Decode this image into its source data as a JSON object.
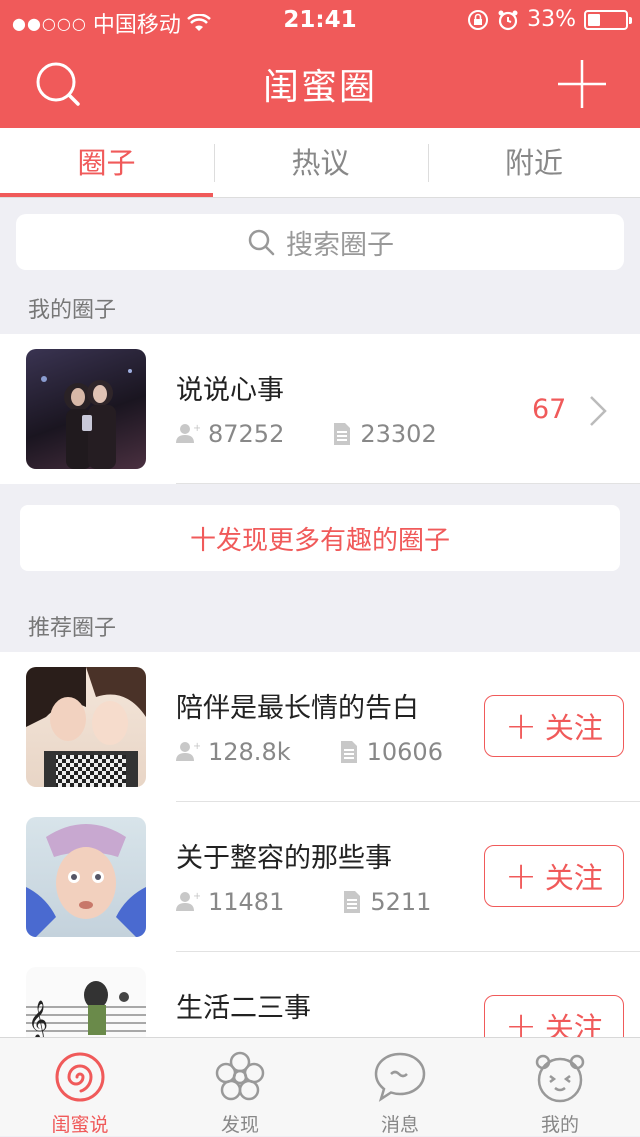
{
  "status_bar": {
    "carrier": "中国移动",
    "time": "21:41",
    "battery": "33%",
    "battery_level": 0.33
  },
  "header": {
    "title": "闺蜜圈",
    "left_icon": "search-icon",
    "right_icon": "plus-icon"
  },
  "tabs": [
    {
      "label": "圈子",
      "active": true
    },
    {
      "label": "热议",
      "active": false
    },
    {
      "label": "附近",
      "active": false
    }
  ],
  "search": {
    "placeholder": "搜索圈子"
  },
  "my_circles": {
    "title": "我的圈子",
    "items": [
      {
        "name": "说说心事",
        "members": "87252",
        "posts": "23302",
        "badge": "67"
      }
    ]
  },
  "discover_more": {
    "label": "十发现更多有趣的圈子"
  },
  "recommended": {
    "title": "推荐圈子",
    "follow_label": "关注",
    "items": [
      {
        "name": "陪伴是最长情的告白",
        "members": "128.8k",
        "posts": "10606"
      },
      {
        "name": "关于整容的那些事",
        "members": "11481",
        "posts": "5211"
      },
      {
        "name": "生活二三事",
        "members": "",
        "posts": ""
      }
    ]
  },
  "tabbar": [
    {
      "label": "闺蜜说",
      "icon": "swirl-icon",
      "active": true
    },
    {
      "label": "发现",
      "icon": "flower-icon",
      "active": false
    },
    {
      "label": "消息",
      "icon": "chat-bubble-icon",
      "active": false
    },
    {
      "label": "我的",
      "icon": "bear-face-icon",
      "active": false
    }
  ],
  "colors": {
    "accent": "#f05a5a",
    "background": "#efeff4"
  }
}
